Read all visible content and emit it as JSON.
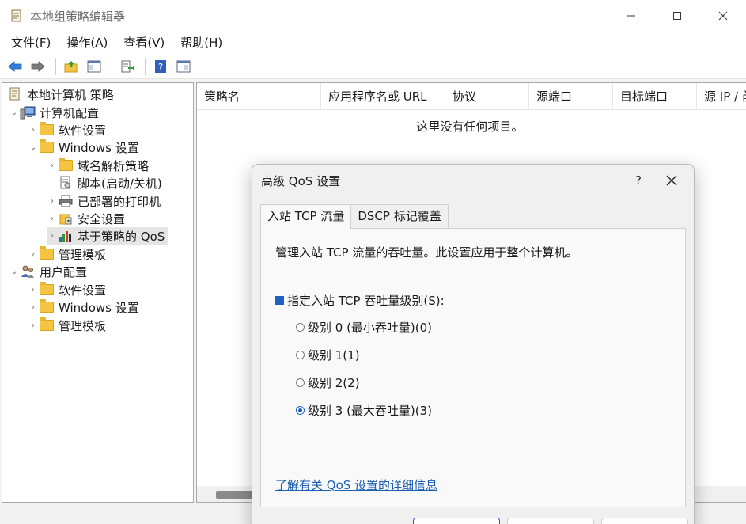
{
  "window": {
    "title": "本地组策略编辑器",
    "icon": "policy-editor-icon"
  },
  "menu": [
    {
      "label": "文件(F)"
    },
    {
      "label": "操作(A)"
    },
    {
      "label": "查看(V)"
    },
    {
      "label": "帮助(H)"
    }
  ],
  "tree": {
    "root": "本地计算机 策略",
    "computer_config": "计算机配置",
    "cc_software": "软件设置",
    "cc_windows": "Windows 设置",
    "cc_dns": "域名解析策略",
    "cc_scripts": "脚本(启动/关机)",
    "cc_printers": "已部署的打印机",
    "cc_security": "安全设置",
    "cc_qos": "基于策略的 QoS",
    "cc_admin": "管理模板",
    "user_config": "用户配置",
    "uc_software": "软件设置",
    "uc_windows": "Windows 设置",
    "uc_admin": "管理模板"
  },
  "list": {
    "columns": [
      "策略名",
      "应用程序名或 URL",
      "协议",
      "源端口",
      "目标端口",
      "源 IP / 前"
    ],
    "empty_message": "这里没有任何项目。"
  },
  "dialog": {
    "title": "高级 QoS 设置",
    "help": "?",
    "tabs": [
      {
        "label": "入站 TCP 流量",
        "active": true
      },
      {
        "label": "DSCP 标记覆盖",
        "active": false
      }
    ],
    "description": "管理入站 TCP 流量的吞吐量。此设置应用于整个计算机。",
    "checkbox_label": "指定入站 TCP 吞吐量级别(S):",
    "checkbox_checked": true,
    "levels": [
      {
        "label": "级别 0 (最小吞吐量)(0)",
        "checked": false
      },
      {
        "label": "级别 1(1)",
        "checked": false
      },
      {
        "label": "级别 2(2)",
        "checked": false
      },
      {
        "label": "级别 3 (最大吞吐量)(3)",
        "checked": true
      }
    ],
    "link": "了解有关 QoS 设置的详细信息"
  },
  "colors": {
    "accent": "#1f5fbf",
    "link": "#1a5fb4"
  }
}
